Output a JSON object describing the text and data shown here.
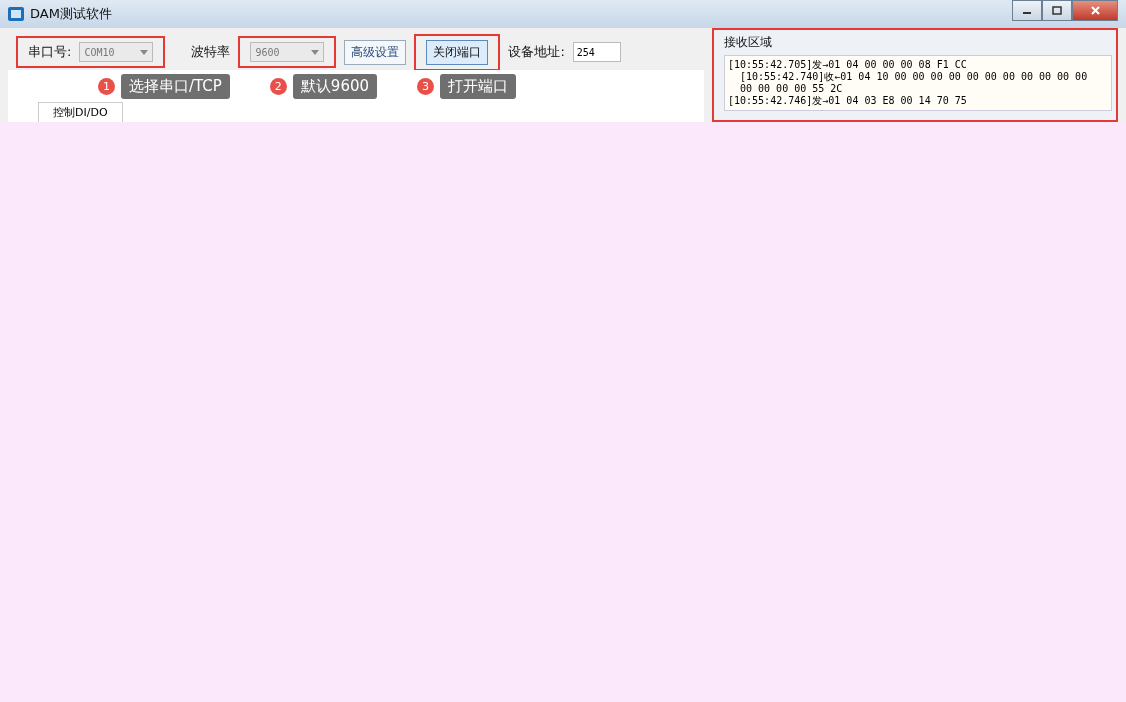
{
  "window": {
    "title": "DAM测试软件"
  },
  "toolbar": {
    "port_label": "串口号:",
    "port_value": "COM10",
    "baud_label": "波特率",
    "baud_value": "9600",
    "advanced_button": "高级设置",
    "close_port_button": "关闭端口",
    "address_label": "设备地址:",
    "address_value": "254"
  },
  "callouts": [
    {
      "number": "1",
      "text": "选择串口/TCP"
    },
    {
      "number": "2",
      "text": "默认9600"
    },
    {
      "number": "3",
      "text": "打开端口"
    }
  ],
  "tabs": [
    {
      "label": "控制DI/DO",
      "selected": true
    }
  ],
  "receive": {
    "title": "接收区域",
    "lines": [
      "[10:55:42.705]发→01 04 00 00 00 08 F1 CC",
      "[10:55:42.740]收←01 04 10 00 00 00 00 00 00 00 00 00 00 00 00 00 00 00 55 2C",
      "[10:55:42.746]发→01 04 03 E8 00 14 70 75"
    ]
  }
}
